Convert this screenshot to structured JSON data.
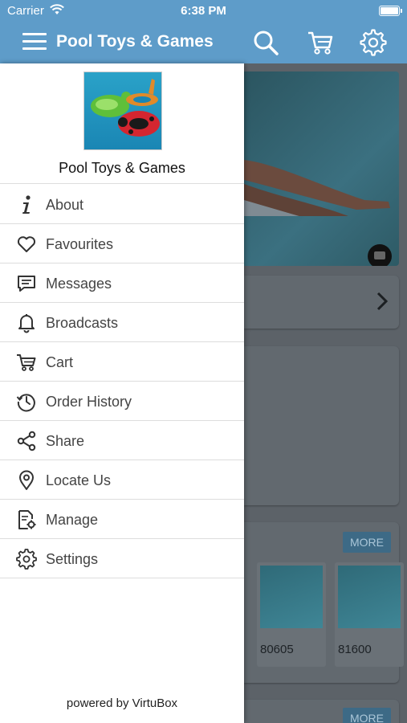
{
  "status_bar": {
    "carrier": "Carrier",
    "time": "6:38 PM"
  },
  "header": {
    "title": "Pool Toys & Games",
    "accent_color": "#5e9cc9"
  },
  "drawer": {
    "store_name": "Pool Toys & Games",
    "menu": [
      {
        "label": "About",
        "icon": "info-icon"
      },
      {
        "label": "Favourites",
        "icon": "heart-icon"
      },
      {
        "label": "Messages",
        "icon": "message-icon"
      },
      {
        "label": "Broadcasts",
        "icon": "bell-icon"
      },
      {
        "label": "Cart",
        "icon": "cart-icon"
      },
      {
        "label": "Order History",
        "icon": "history-icon"
      },
      {
        "label": "Share",
        "icon": "share-icon"
      },
      {
        "label": "Locate Us",
        "icon": "location-pin-icon"
      },
      {
        "label": "Manage",
        "icon": "manage-icon"
      },
      {
        "label": "Settings",
        "icon": "gear-icon"
      }
    ],
    "footer": "powered by VirtuBox"
  },
  "background": {
    "more_label": "MORE",
    "products": [
      {
        "sku": "80605"
      },
      {
        "sku": "81600"
      }
    ]
  }
}
